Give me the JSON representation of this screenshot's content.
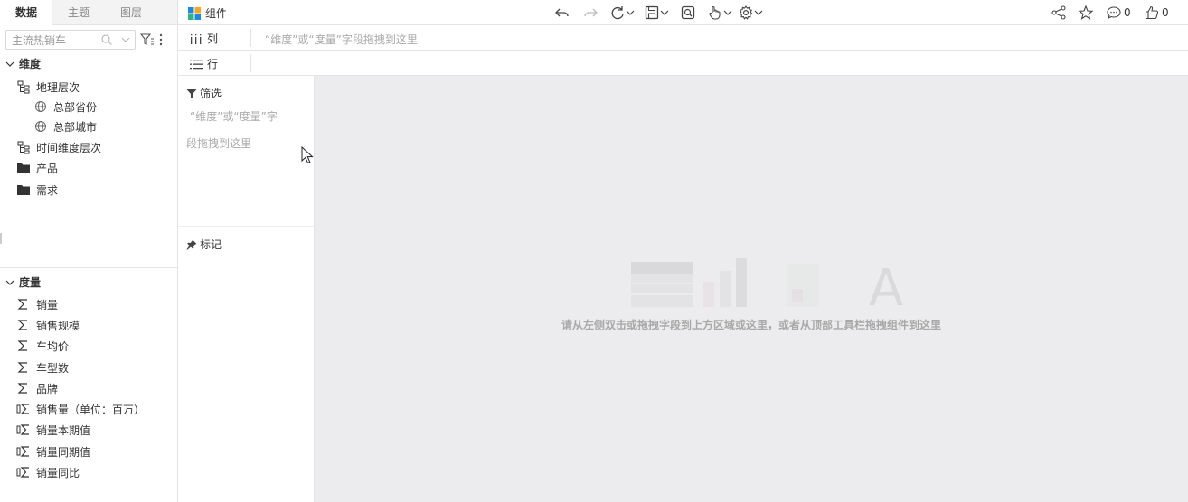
{
  "left_panel": {
    "tabs": [
      {
        "label": "数据",
        "active": true
      },
      {
        "label": "主题",
        "active": false
      },
      {
        "label": "图层",
        "active": false
      }
    ],
    "search": {
      "value": "主流热销车",
      "placeholder": "主流热销车"
    },
    "dimensions": {
      "title": "维度",
      "items": [
        {
          "label": "地理层次",
          "icon": "hierarchy-icon"
        },
        {
          "label": "总部省份",
          "icon": "globe-icon"
        },
        {
          "label": "总部城市",
          "icon": "globe-icon"
        },
        {
          "label": "时间维度层次",
          "icon": "hierarchy-icon"
        },
        {
          "label": "产品",
          "icon": "folder-icon"
        },
        {
          "label": "需求",
          "icon": "folder-icon"
        }
      ]
    },
    "measures": {
      "title": "度量",
      "items": [
        {
          "label": "销量",
          "icon": "sigma-icon"
        },
        {
          "label": "销售规模",
          "icon": "sigma-icon"
        },
        {
          "label": "车均价",
          "icon": "sigma-icon"
        },
        {
          "label": "车型数",
          "icon": "sigma-icon"
        },
        {
          "label": "品牌",
          "icon": "sigma-icon"
        },
        {
          "label": "销售量（单位：百万）",
          "icon": "calc-sigma-icon"
        },
        {
          "label": "销量本期值",
          "icon": "calc-sigma-icon"
        },
        {
          "label": "销量同期值",
          "icon": "calc-sigma-icon"
        },
        {
          "label": "销量同比",
          "icon": "calc-sigma-icon"
        }
      ]
    }
  },
  "toolbar": {
    "title": "组件",
    "comments_count": "0",
    "likes_count": "0"
  },
  "shelves": {
    "columns": {
      "label": "列",
      "hint": "“维度”或“度量”字段拖拽到这里"
    },
    "rows": {
      "label": "行"
    }
  },
  "filter_panel": {
    "title": "筛选",
    "hint_line1": "“维度”或“度量”字",
    "hint_line2": "段拖拽到这里"
  },
  "mark_panel": {
    "title": "标记"
  },
  "canvas": {
    "hint": "请从左侧双击或拖拽字段到上方区域或这里，或者从顶部工具栏拖拽组件到这里"
  },
  "colors": {
    "accent_blue": "#1e88e5",
    "logo_green": "#2fb67a",
    "logo_orange": "#f5a623",
    "canvas_bg": "#ececee"
  }
}
